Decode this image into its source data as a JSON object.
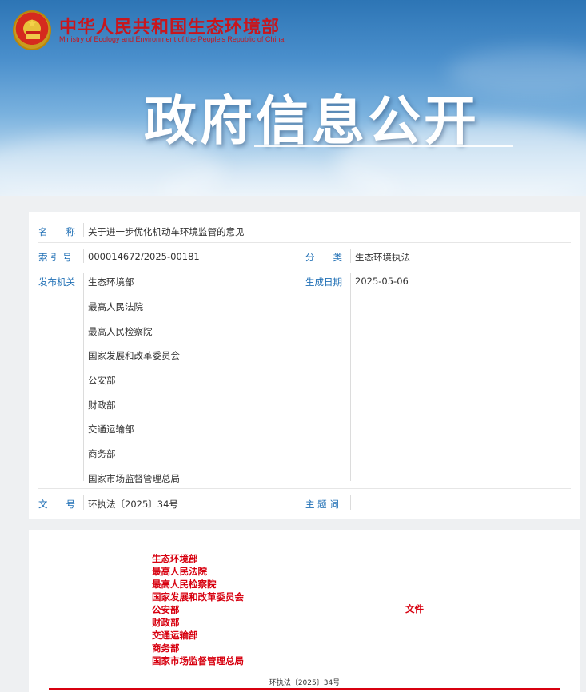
{
  "header": {
    "ministry_cn": "中华人民共和国生态环境部",
    "ministry_en": "Ministry of Ecology and Environment of the People's Republic of China",
    "headline": "政府信息公开",
    "emblem_icon": "national-emblem-icon"
  },
  "meta": {
    "name_label": "名　　称",
    "name_value": "关于进一步优化机动车环境监管的意见",
    "index_label": "索 引 号",
    "index_value": "000014672/2025-00181",
    "category_label": "分　　类",
    "category_value": "生态环境执法",
    "publisher_label": "发布机关",
    "publishers": [
      "生态环境部",
      "最高人民法院",
      "最高人民检察院",
      "国家发展和改革委员会",
      "公安部",
      "财政部",
      "交通运输部",
      "商务部",
      "国家市场监督管理总局"
    ],
    "date_label": "生成日期",
    "date_value": "2025-05-06",
    "docno_label": "文　　号",
    "docno_value": "环执法〔2025〕34号",
    "keywords_label": "主 题 词",
    "keywords_value": ""
  },
  "document": {
    "issuers": [
      "生态环境部",
      "最高人民法院",
      "最高人民检察院",
      "国家发展和改革委员会",
      "公安部",
      "财政部",
      "交通运输部",
      "商务部",
      "国家市场监督管理总局"
    ],
    "wenjian": "文件",
    "docnum": "环执法〔2025〕34号"
  },
  "colors": {
    "brand_red": "#c8161d",
    "label_blue": "#1f6fb5",
    "doc_red": "#d7000f"
  }
}
